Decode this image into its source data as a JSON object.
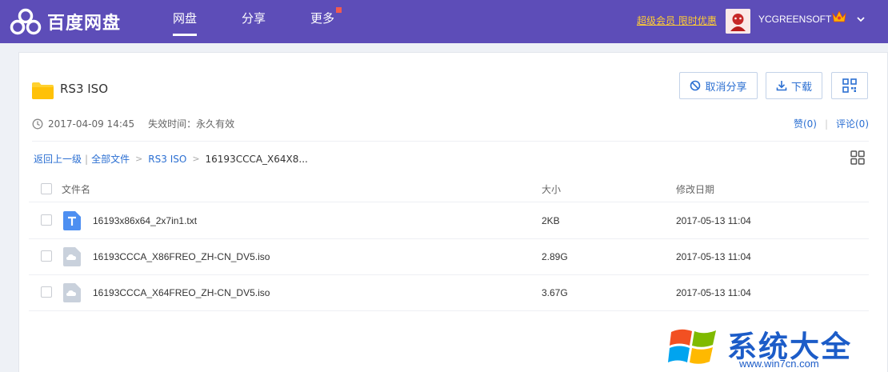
{
  "app": {
    "logo_text": "百度网盘"
  },
  "nav": {
    "tabs": [
      {
        "label": "网盘",
        "active": true
      },
      {
        "label": "分享",
        "active": false
      },
      {
        "label": "更多",
        "active": false,
        "has_dot": true
      }
    ],
    "promo": "超级会员 限时优惠",
    "username": "YCGREENSOFT"
  },
  "share": {
    "title": "RS3 ISO",
    "date": "2017-04-09 14:45",
    "expire": "失效时间：永久有效",
    "buttons": {
      "cancel": "取消分享",
      "download": "下载"
    },
    "like": "赞(0)",
    "comment": "评论(0)"
  },
  "breadcrumb": {
    "back": "返回上一级",
    "all": "全部文件",
    "folder": "RS3 ISO",
    "current": "16193CCCA_X64X8..."
  },
  "table": {
    "headers": {
      "name": "文件名",
      "size": "大小",
      "date": "修改日期"
    },
    "rows": [
      {
        "name": "16193x86x64_2x7in1.txt",
        "size": "2KB",
        "date": "2017-05-13 11:04",
        "icon": "txt-file-icon"
      },
      {
        "name": "16193CCCA_X86FREO_ZH-CN_DV5.iso",
        "size": "2.89G",
        "date": "2017-05-13 11:04",
        "icon": "iso-file-icon"
      },
      {
        "name": "16193CCCA_X64FREO_ZH-CN_DV5.iso",
        "size": "3.67G",
        "date": "2017-05-13 11:04",
        "icon": "iso-file-icon"
      }
    ]
  },
  "watermark": {
    "text": "系统大全",
    "url": "www.win7cn.com"
  },
  "colors": {
    "topbar": "#5d4db8",
    "accent": "#2b6fd2",
    "promo": "#ffcc33"
  }
}
